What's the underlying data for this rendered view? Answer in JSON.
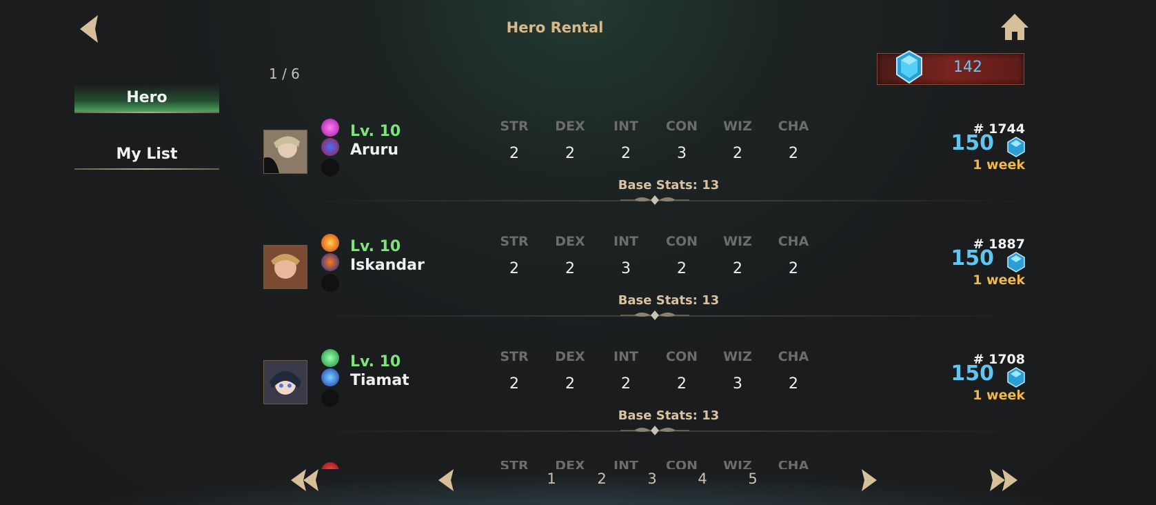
{
  "header": {
    "title": "Hero Rental",
    "page_indicator": "1 / 6",
    "currency_value": "142"
  },
  "tabs": [
    {
      "label": "Hero",
      "active": true
    },
    {
      "label": "My List",
      "active": false
    }
  ],
  "stat_labels": [
    "STR",
    "DEX",
    "INT",
    "CON",
    "WIZ",
    "CHA"
  ],
  "heroes": [
    {
      "level": "Lv. 10",
      "name": "Aruru",
      "stats": [
        "2",
        "2",
        "2",
        "3",
        "2",
        "2"
      ],
      "base": "Base Stats: 13",
      "id": "# 1744",
      "price": "150",
      "duration": "1 week"
    },
    {
      "level": "Lv. 10",
      "name": "Iskandar",
      "stats": [
        "2",
        "2",
        "3",
        "2",
        "2",
        "2"
      ],
      "base": "Base Stats: 13",
      "id": "# 1887",
      "price": "150",
      "duration": "1 week"
    },
    {
      "level": "Lv. 10",
      "name": "Tiamat",
      "stats": [
        "2",
        "2",
        "2",
        "2",
        "3",
        "2"
      ],
      "base": "Base Stats: 13",
      "id": "# 1708",
      "price": "150",
      "duration": "1 week"
    }
  ],
  "pagination": {
    "pages": [
      "1",
      "2",
      "3",
      "4",
      "5"
    ]
  },
  "colors": {
    "gold": "#d9b98a",
    "level_green": "#7ee37a",
    "price_blue": "#5fc6f2",
    "duration_gold": "#eeb84a"
  }
}
